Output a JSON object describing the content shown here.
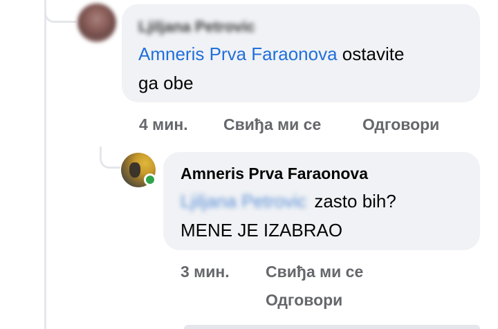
{
  "comments": [
    {
      "author": "Ljiljana Petrovic",
      "mention": "Amneris Prva Faraonova",
      "text_line1": "ostavite",
      "text_line2": "ga obe",
      "time": "4 мин.",
      "like_label": "Свиђа ми се",
      "reply_label": "Одговори",
      "author_blurred": true
    },
    {
      "author": "Amneris Prva Faraonova",
      "mention": "Ljiljana Petrovic",
      "text_line1": "zasto bih?",
      "text_line2": "MENE JE IZABRAO",
      "time": "3 мин.",
      "like_label": "Свиђа ми се",
      "reply_label": "Одговори",
      "online": true,
      "mention_blurred": true
    }
  ],
  "colors": {
    "bubble_bg": "#f0f2f5",
    "mention": "#216fdb",
    "text": "#050505",
    "secondary": "#65676b",
    "online": "#31a24c",
    "thread_line": "#e4e6eb"
  }
}
